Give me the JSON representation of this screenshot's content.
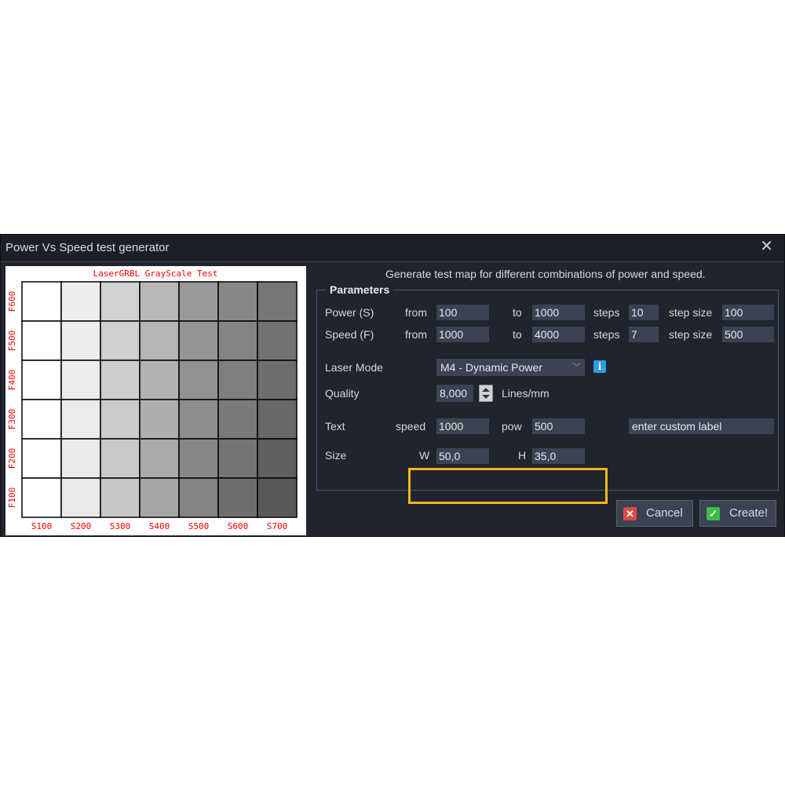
{
  "window": {
    "title": "Power Vs Speed test generator"
  },
  "preview": {
    "title": "LaserGRBL GrayScale Test",
    "row_labels": [
      "F600",
      "F500",
      "F400",
      "F300",
      "F200",
      "F100"
    ],
    "column_labels": [
      "S100",
      "S200",
      "S300",
      "S400",
      "S500",
      "S600",
      "S700"
    ],
    "cell_colors": [
      [
        "#ffffff",
        "#eeeeee",
        "#d2d2d2",
        "#b8b8b8",
        "#999999",
        "#888888",
        "#767676"
      ],
      [
        "#ffffff",
        "#ededed",
        "#d0d0d0",
        "#b5b5b5",
        "#959595",
        "#848484",
        "#727272"
      ],
      [
        "#ffffff",
        "#ececec",
        "#cecece",
        "#b2b2b2",
        "#919191",
        "#808080",
        "#6e6e6e"
      ],
      [
        "#ffffff",
        "#ebebeb",
        "#cbcbcb",
        "#aeaeae",
        "#8d8d8d",
        "#7a7a7a",
        "#686868"
      ],
      [
        "#ffffff",
        "#eaeaea",
        "#c9c9c9",
        "#aaaaaa",
        "#888888",
        "#747474",
        "#606060"
      ],
      [
        "#ffffff",
        "#e9e9e9",
        "#c6c6c6",
        "#a6a6a6",
        "#838383",
        "#6e6e6e",
        "#595959"
      ]
    ]
  },
  "description": "Generate test map for different combinations of power and speed.",
  "parameters": {
    "title": "Parameters",
    "power": {
      "label": "Power (S)",
      "from_label": "from",
      "from": "100",
      "to_label": "to",
      "to": "1000",
      "steps_label": "steps",
      "steps": "10",
      "step_size_label": "step size",
      "step_size": "100"
    },
    "speed": {
      "label": "Speed (F)",
      "from_label": "from",
      "from": "1000",
      "to_label": "to",
      "to": "4000",
      "steps_label": "steps",
      "steps": "7",
      "step_size_label": "step size",
      "step_size": "500"
    },
    "laser_mode": {
      "label": "Laser Mode",
      "value": "M4 - Dynamic Power",
      "info_glyph": "i"
    },
    "quality": {
      "label": "Quality",
      "value": "8,000",
      "unit": "Lines/mm"
    },
    "text": {
      "label": "Text",
      "speed_label": "speed",
      "speed": "1000",
      "pow_label": "pow",
      "pow": "500",
      "custom_label": "enter custom label"
    },
    "size": {
      "label": "Size",
      "w_label": "W",
      "w": "50,0",
      "h_label": "H",
      "h": "35,0"
    }
  },
  "buttons": {
    "cancel": "Cancel",
    "create": "Create!"
  },
  "colors": {
    "dialog_bg": "#1f242d",
    "field_bg": "#3b4352",
    "highlight": "#f3b51b",
    "chart_text": "#ff0000",
    "cancel_icon": "#e04848",
    "create_icon": "#3cbf4a"
  }
}
